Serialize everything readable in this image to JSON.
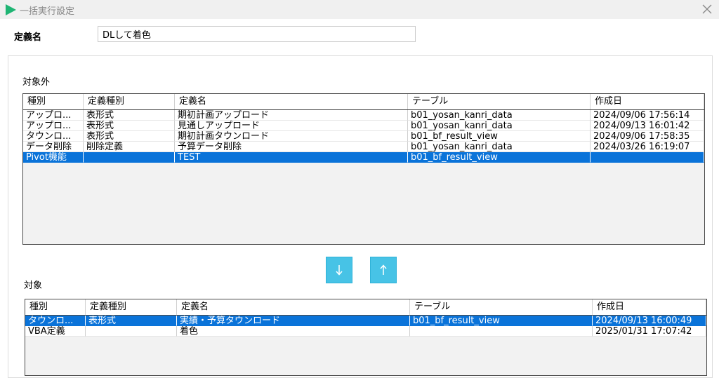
{
  "window": {
    "title": "一括実行設定"
  },
  "definition": {
    "label": "定義名",
    "value": "DLして着色"
  },
  "excluded": {
    "label": "対象外",
    "columns": [
      "種別",
      "定義種別",
      "定義名",
      "テーブル",
      "作成日"
    ],
    "rows": [
      [
        "アップロ...",
        "表形式",
        "期初計画アップロード",
        "b01_yosan_kanri_data",
        "2024/09/06 17:56:14"
      ],
      [
        "アップロ...",
        "表形式",
        "見通しアップロード",
        "b01_yosan_kanri_data",
        "2024/09/13 16:01:42"
      ],
      [
        "タウンロ...",
        "表形式",
        "期初計画タウンロード",
        "b01_bf_result_view",
        "2024/09/06 17:58:35"
      ],
      [
        "データ削除",
        "削除定義",
        "予算データ削除",
        "b01_yosan_kanri_data",
        "2024/03/26 16:19:07"
      ],
      [
        "Pivot機能",
        "",
        "TEST",
        "b01_bf_result_view",
        ""
      ]
    ],
    "selected_index": 4
  },
  "buttons": {
    "down": "↓",
    "up": "↑"
  },
  "target": {
    "label": "対象",
    "columns": [
      "種別",
      "定義種別",
      "定義名",
      "テーブル",
      "作成日"
    ],
    "rows": [
      [
        "タウンロ...",
        "表形式",
        "実績・予算タウンロード",
        "b01_bf_result_view",
        "2024/09/13 16:00:49"
      ],
      [
        "VBA定義",
        "",
        "着色",
        "",
        "2025/01/31 17:07:42"
      ]
    ],
    "selected_index": 0
  },
  "colors": {
    "selection": "#0a73d9",
    "move_button": "#47c3e6",
    "title_icon": "#1fb574"
  },
  "icons": {
    "title": "play-icon",
    "close": "close-icon",
    "down": "arrow-down-icon",
    "up": "arrow-up-icon"
  }
}
